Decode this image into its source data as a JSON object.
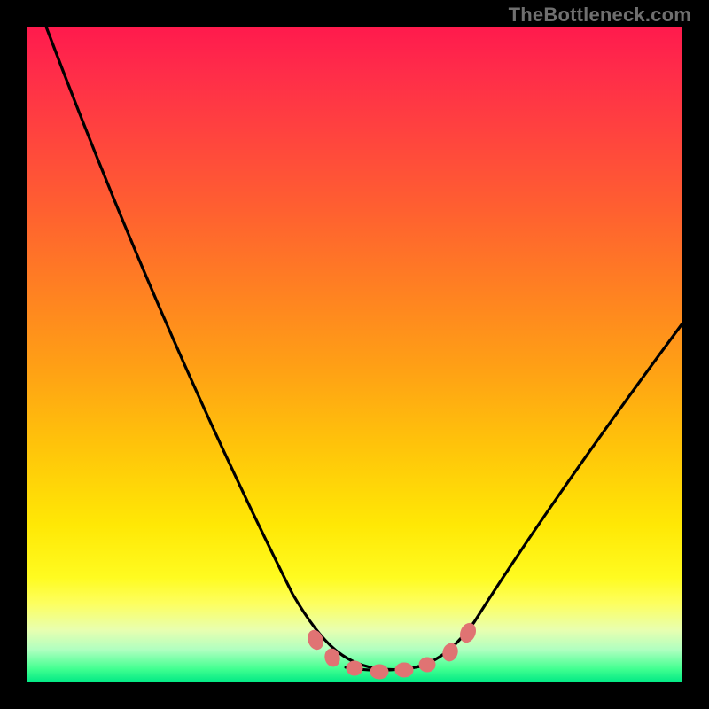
{
  "watermark": "TheBottleneck.com",
  "colors": {
    "background": "#000000",
    "gradient_top": "#ff1a4d",
    "gradient_mid": "#ffe805",
    "gradient_bottom": "#00e885",
    "curve": "#000000",
    "markers": "#e07373"
  },
  "chart_data": {
    "type": "line",
    "title": "",
    "xlabel": "",
    "ylabel": "",
    "xlim": [
      0,
      100
    ],
    "ylim": [
      0,
      100
    ],
    "x": [
      3,
      10,
      20,
      30,
      40,
      48,
      52,
      56,
      60,
      64,
      70,
      80,
      90,
      100
    ],
    "values": [
      100,
      84,
      64,
      44,
      24,
      8,
      2,
      0,
      0,
      2,
      8,
      22,
      38,
      55
    ],
    "markers": {
      "x": [
        44,
        47,
        50,
        54,
        58,
        62,
        65,
        68
      ],
      "y": [
        6,
        3,
        1,
        0,
        0,
        1,
        3,
        6
      ]
    },
    "notes": "Valley-shaped bottleneck curve over a red→yellow→green vertical gradient. Axes have no visible tick labels; values are estimated on a 0–100 normalized scale. Salmon markers cluster at the valley bottom."
  }
}
